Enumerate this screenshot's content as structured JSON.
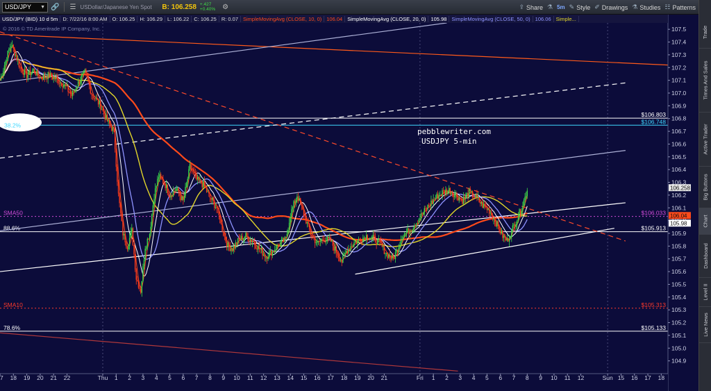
{
  "toolbar": {
    "symbol": "USD/JPY",
    "description": "USDollar/Japanese Yen Spot",
    "bid": "B: 106.258",
    "change": "+.427",
    "change_pct": "+0.40%",
    "actions": [
      {
        "icon": "share-icon",
        "label": "Share"
      },
      {
        "icon": "flask-icon",
        "label": ""
      },
      {
        "icon": "interval-icon",
        "label": "5m"
      },
      {
        "icon": "style-icon",
        "label": "Style"
      },
      {
        "icon": "drawings-icon",
        "label": "Drawings"
      },
      {
        "icon": "studies-icon",
        "label": "Studies"
      },
      {
        "icon": "patterns-icon",
        "label": "Patterns"
      }
    ]
  },
  "infobar": {
    "items": [
      {
        "text": "USD/JPY (BID) 10 d 5m",
        "color": "#ffffff"
      },
      {
        "text": "D: 7/22/16 8:00 AM",
        "color": "#dcdcdc"
      },
      {
        "text": "O: 106.25",
        "color": "#dcdcdc"
      },
      {
        "text": "H: 106.29",
        "color": "#dcdcdc"
      },
      {
        "text": "L: 106.22",
        "color": "#dcdcdc"
      },
      {
        "text": "C: 106.25",
        "color": "#dcdcdc"
      },
      {
        "text": "R: 0.07",
        "color": "#dcdcdc"
      },
      {
        "text": "SimpleMovingAvg (CLOSE, 10, 0)",
        "color": "#ff4a1a"
      },
      {
        "text": "106.04",
        "color": "#ff4a1a"
      },
      {
        "text": "SimpleMovingAvg (CLOSE, 20, 0)",
        "color": "#ffffff"
      },
      {
        "text": "105.98",
        "color": "#ffffff"
      },
      {
        "text": "SimpleMovingAvg (CLOSE, 50, 0)",
        "color": "#8f94ff"
      },
      {
        "text": "106.06",
        "color": "#8f94ff"
      },
      {
        "text": "Simple...",
        "color": "#e2d62a"
      }
    ]
  },
  "copyright": "© 2016 © TD Ameritrade IP Company, Inc.",
  "annotation": {
    "line1": "pebblewriter.com",
    "line2": "USDJPY 5-min"
  },
  "side_tabs": [
    "Trade",
    "Times And Sales",
    "Active Trader",
    "Big Buttons",
    "Chart",
    "Dashboard",
    "Level II",
    "Live News"
  ],
  "colors": {
    "background": "#0c0c3a",
    "up": "#3fdc49",
    "down": "#ff3a1a",
    "sma10": "#ff4a1a",
    "sma20": "#ffffff",
    "sma50": "#8f94ff",
    "sma_slow": "#e2d62a",
    "sma_long": "#ff4a1a"
  },
  "chart_data": {
    "type": "candlestick",
    "title": "USD/JPY (BID) 10 d 5m",
    "ylim": [
      104.8,
      107.55
    ],
    "yticks": [
      104.9,
      105.0,
      105.1,
      105.2,
      105.3,
      105.4,
      105.5,
      105.6,
      105.7,
      105.8,
      105.9,
      106.0,
      106.1,
      106.2,
      106.3,
      106.4,
      106.5,
      106.6,
      106.7,
      106.8,
      106.9,
      107.0,
      107.1,
      107.2,
      107.3,
      107.4,
      107.5
    ],
    "xticks": [
      "17",
      "18",
      "19",
      "20",
      "21",
      "22",
      "Thu",
      "1",
      "2",
      "3",
      "4",
      "5",
      "6",
      "7",
      "8",
      "9",
      "10",
      "11",
      "12",
      "13",
      "14",
      "15",
      "16",
      "17",
      "18",
      "19",
      "20",
      "21",
      "Fri",
      "1",
      "2",
      "3",
      "4",
      "5",
      "6",
      "7",
      "8",
      "9",
      "10",
      "11",
      "12",
      "Sun",
      "15",
      "16",
      "17",
      "18"
    ],
    "xtick_bars": [
      0,
      12,
      24,
      36,
      48,
      60,
      92,
      104,
      116,
      128,
      140,
      152,
      164,
      176,
      188,
      200,
      212,
      224,
      236,
      248,
      260,
      272,
      284,
      296,
      308,
      320,
      332,
      344,
      376,
      388,
      400,
      412,
      424,
      436,
      448,
      460,
      472,
      484,
      496,
      508,
      520,
      544,
      556,
      568,
      580,
      592
    ],
    "last_bar": 472,
    "total_bars": 598,
    "price_path": [
      [
        0,
        107.1
      ],
      [
        4,
        107.22
      ],
      [
        8,
        107.34
      ],
      [
        10,
        107.38
      ],
      [
        14,
        107.3
      ],
      [
        18,
        107.2
      ],
      [
        24,
        107.14
      ],
      [
        30,
        107.18
      ],
      [
        36,
        107.12
      ],
      [
        44,
        107.14
      ],
      [
        52,
        107.1
      ],
      [
        58,
        107.06
      ],
      [
        64,
        106.98
      ],
      [
        70,
        107.08
      ],
      [
        76,
        107.16
      ],
      [
        82,
        107.0
      ],
      [
        90,
        106.9
      ],
      [
        96,
        106.78
      ],
      [
        102,
        106.7
      ],
      [
        106,
        106.2
      ],
      [
        110,
        105.9
      ],
      [
        114,
        105.8
      ],
      [
        118,
        105.92
      ],
      [
        122,
        105.55
      ],
      [
        126,
        105.45
      ],
      [
        130,
        105.8
      ],
      [
        134,
        105.9
      ],
      [
        138,
        106.2
      ],
      [
        142,
        106.35
      ],
      [
        148,
        106.28
      ],
      [
        152,
        106.2
      ],
      [
        158,
        106.25
      ],
      [
        164,
        106.15
      ],
      [
        170,
        106.42
      ],
      [
        176,
        106.32
      ],
      [
        182,
        106.28
      ],
      [
        188,
        106.18
      ],
      [
        194,
        106.1
      ],
      [
        200,
        105.9
      ],
      [
        204,
        105.8
      ],
      [
        208,
        105.78
      ],
      [
        214,
        105.85
      ],
      [
        220,
        105.88
      ],
      [
        226,
        105.84
      ],
      [
        232,
        105.78
      ],
      [
        238,
        105.72
      ],
      [
        244,
        105.76
      ],
      [
        250,
        105.82
      ],
      [
        256,
        105.85
      ],
      [
        260,
        106.05
      ],
      [
        266,
        106.2
      ],
      [
        270,
        106.1
      ],
      [
        274,
        106.0
      ],
      [
        278,
        105.9
      ],
      [
        284,
        105.82
      ],
      [
        290,
        105.86
      ],
      [
        296,
        105.84
      ],
      [
        302,
        105.74
      ],
      [
        306,
        105.68
      ],
      [
        310,
        105.76
      ],
      [
        316,
        105.82
      ],
      [
        322,
        105.85
      ],
      [
        328,
        105.88
      ],
      [
        334,
        105.86
      ],
      [
        340,
        105.82
      ],
      [
        346,
        105.74
      ],
      [
        352,
        105.7
      ],
      [
        356,
        105.78
      ],
      [
        360,
        105.88
      ],
      [
        366,
        105.92
      ],
      [
        372,
        105.98
      ],
      [
        378,
        106.05
      ],
      [
        384,
        106.12
      ],
      [
        390,
        106.18
      ],
      [
        396,
        106.22
      ],
      [
        402,
        106.24
      ],
      [
        408,
        106.2
      ],
      [
        414,
        106.16
      ],
      [
        420,
        106.22
      ],
      [
        426,
        106.18
      ],
      [
        432,
        106.12
      ],
      [
        438,
        106.08
      ],
      [
        442,
        106.02
      ],
      [
        446,
        105.95
      ],
      [
        450,
        105.88
      ],
      [
        454,
        105.84
      ],
      [
        458,
        105.92
      ],
      [
        462,
        106.0
      ],
      [
        466,
        106.08
      ],
      [
        470,
        106.18
      ],
      [
        472,
        106.25
      ]
    ],
    "horizontal_levels": [
      {
        "price": 106.803,
        "label": "$106.803",
        "style": "solid",
        "color": "#ffffff"
      },
      {
        "price": 106.748,
        "label": "$106.748",
        "style": "solid",
        "color": "#3fd8ff"
      },
      {
        "price": 106.033,
        "label": "$106.033",
        "style": "dotted",
        "color": "#d04cd8",
        "left_label": "SMA50"
      },
      {
        "price": 105.913,
        "label": "$105.913",
        "style": "solid",
        "color": "#ffffff",
        "left_label": "88.6%"
      },
      {
        "price": 105.313,
        "label": "$105.313",
        "style": "dotted",
        "color": "#ff3a2a",
        "left_label": "SMA10"
      },
      {
        "price": 105.133,
        "label": "$105.133",
        "style": "solid",
        "color": "#ffffff",
        "left_label": "78.6%"
      }
    ],
    "fib_label": "38.2%",
    "trendlines": [
      {
        "from": [
          0,
          107.46
        ],
        "to": [
          598,
          107.22
        ],
        "color": "#ff5a1a",
        "style": "solid"
      },
      {
        "from": [
          0,
          107.08
        ],
        "to": [
          400,
          107.55
        ],
        "color": "#aeb2d8",
        "style": "solid"
      },
      {
        "from": [
          0,
          106.49
        ],
        "to": [
          560,
          107.08
        ],
        "color": "#ffffff",
        "style": "dashed"
      },
      {
        "from": [
          0,
          105.92
        ],
        "to": [
          560,
          106.55
        ],
        "color": "#aeb2d8",
        "style": "solid"
      },
      {
        "from": [
          0,
          105.6
        ],
        "to": [
          560,
          106.14
        ],
        "color": "#ffffff",
        "style": "solid"
      },
      {
        "from": [
          318,
          105.58
        ],
        "to": [
          550,
          105.94
        ],
        "color": "#ffffff",
        "style": "solid"
      },
      {
        "from": [
          0,
          107.48
        ],
        "to": [
          560,
          105.84
        ],
        "color": "#ff4a2a",
        "style": "dashed"
      },
      {
        "from": [
          0,
          105.12
        ],
        "to": [
          410,
          104.82
        ],
        "color": "#b0383a",
        "style": "solid"
      }
    ],
    "axis_badges": [
      {
        "price": 106.258,
        "label": "106.258",
        "bg": "#e6e6e6"
      },
      {
        "price": 106.04,
        "label": "106.04",
        "bg": "#ff4a1a"
      },
      {
        "price": 105.98,
        "label": "105.98",
        "bg": "#ffffff"
      }
    ]
  }
}
